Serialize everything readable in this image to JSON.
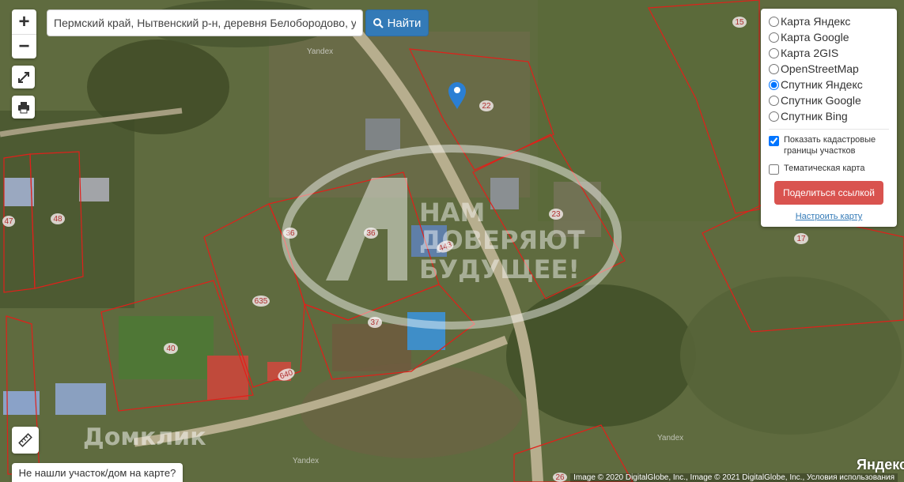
{
  "search": {
    "value": "Пермский край, Нытвенский р-н, деревня Белобородово, ул",
    "button_label": "Найти"
  },
  "zoom": {
    "in_label": "+",
    "out_label": "−"
  },
  "layers": {
    "options": [
      {
        "label": "Карта Яндекс",
        "selected": false
      },
      {
        "label": "Карта Google",
        "selected": false
      },
      {
        "label": "Карта 2GIS",
        "selected": false
      },
      {
        "label": "OpenStreetMap",
        "selected": false
      },
      {
        "label": "Спутник Яндекс",
        "selected": true
      },
      {
        "label": "Спутник Google",
        "selected": false
      },
      {
        "label": "Спутник Bing",
        "selected": false
      }
    ],
    "show_cadastral_label": "Показать кадастровые границы участков",
    "show_cadastral": true,
    "thematic_label": "Тематическая карта",
    "thematic": false,
    "share_label": "Поделиться ссылкой",
    "settings_label": "Настроить карту"
  },
  "watermark": {
    "line1": "НАМ",
    "line2": "ДОВЕРЯЮТ",
    "line3": "БУДУЩЕЕ!",
    "brand": "Домклик"
  },
  "map_labels": {
    "yandex": "Yandex",
    "plots": [
      "15",
      "22",
      "23",
      "36",
      "36",
      "443",
      "37",
      "635",
      "40",
      "640",
      "47",
      "48",
      "17",
      "26"
    ]
  },
  "not_found_label": "Не нашли участок/дом на карте?",
  "copyright": "Image © 2020 DigitalGlobe, Inc., Image © 2021 DigitalGlobe, Inc., Условия использования",
  "yandex_logo": "Яндекс",
  "colors": {
    "parcel_border": "#e0201a",
    "marker": "#2a7fd4",
    "find_button": "#337ab7",
    "share_button": "#d9534f"
  }
}
